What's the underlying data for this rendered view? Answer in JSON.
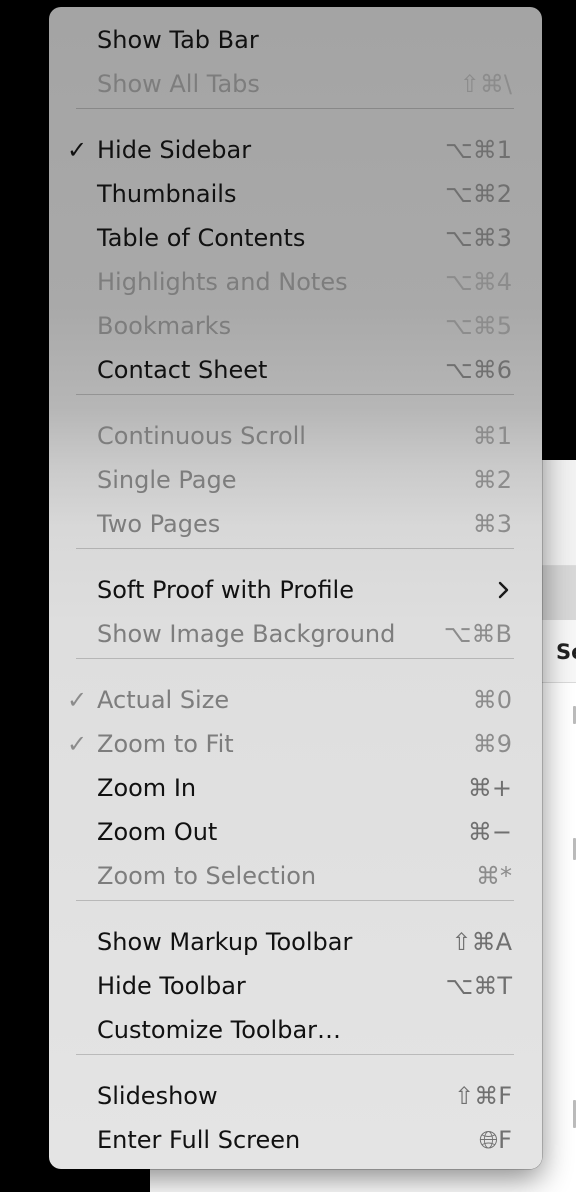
{
  "menu": {
    "sections": [
      {
        "items": [
          {
            "label": "Show Tab Bar",
            "shortcut": "",
            "checked": false,
            "enabled": true
          },
          {
            "label": "Show All Tabs",
            "shortcut": "⇧⌘\\",
            "checked": false,
            "enabled": false
          }
        ]
      },
      {
        "items": [
          {
            "label": "Hide Sidebar",
            "shortcut": "⌥⌘1",
            "checked": true,
            "enabled": true
          },
          {
            "label": "Thumbnails",
            "shortcut": "⌥⌘2",
            "checked": false,
            "enabled": true
          },
          {
            "label": "Table of Contents",
            "shortcut": "⌥⌘3",
            "checked": false,
            "enabled": true
          },
          {
            "label": "Highlights and Notes",
            "shortcut": "⌥⌘4",
            "checked": false,
            "enabled": false
          },
          {
            "label": "Bookmarks",
            "shortcut": "⌥⌘5",
            "checked": false,
            "enabled": false
          },
          {
            "label": "Contact Sheet",
            "shortcut": "⌥⌘6",
            "checked": false,
            "enabled": true
          }
        ]
      },
      {
        "items": [
          {
            "label": "Continuous Scroll",
            "shortcut": "⌘1",
            "checked": false,
            "enabled": false
          },
          {
            "label": "Single Page",
            "shortcut": "⌘2",
            "checked": false,
            "enabled": false
          },
          {
            "label": "Two Pages",
            "shortcut": "⌘3",
            "checked": false,
            "enabled": false
          }
        ]
      },
      {
        "items": [
          {
            "label": "Soft Proof with Profile",
            "shortcut": "",
            "checked": false,
            "enabled": true,
            "submenu": true
          },
          {
            "label": "Show Image Background",
            "shortcut": "⌥⌘B",
            "checked": false,
            "enabled": false
          }
        ]
      },
      {
        "items": [
          {
            "label": "Actual Size",
            "shortcut": "⌘0",
            "checked": true,
            "enabled": false
          },
          {
            "label": "Zoom to Fit",
            "shortcut": "⌘9",
            "checked": true,
            "enabled": false
          },
          {
            "label": "Zoom In",
            "shortcut": "⌘+",
            "checked": false,
            "enabled": true
          },
          {
            "label": "Zoom Out",
            "shortcut": "⌘−",
            "checked": false,
            "enabled": true
          },
          {
            "label": "Zoom to Selection",
            "shortcut": "⌘*",
            "checked": false,
            "enabled": false
          }
        ]
      },
      {
        "items": [
          {
            "label": "Show Markup Toolbar",
            "shortcut": "⇧⌘A",
            "checked": false,
            "enabled": true
          },
          {
            "label": "Hide Toolbar",
            "shortcut": "⌥⌘T",
            "checked": false,
            "enabled": true
          },
          {
            "label": "Customize Toolbar…",
            "shortcut": "",
            "checked": false,
            "enabled": true
          }
        ]
      },
      {
        "items": [
          {
            "label": "Slideshow",
            "shortcut": "⇧⌘F",
            "checked": false,
            "enabled": true
          },
          {
            "label": "Enter Full Screen",
            "shortcut": "🌐︎F",
            "checked": false,
            "enabled": true
          }
        ]
      }
    ],
    "check_glyph": "✓",
    "submenu_icon": "chevron-right-icon"
  },
  "background": {
    "column_label": "Se"
  }
}
